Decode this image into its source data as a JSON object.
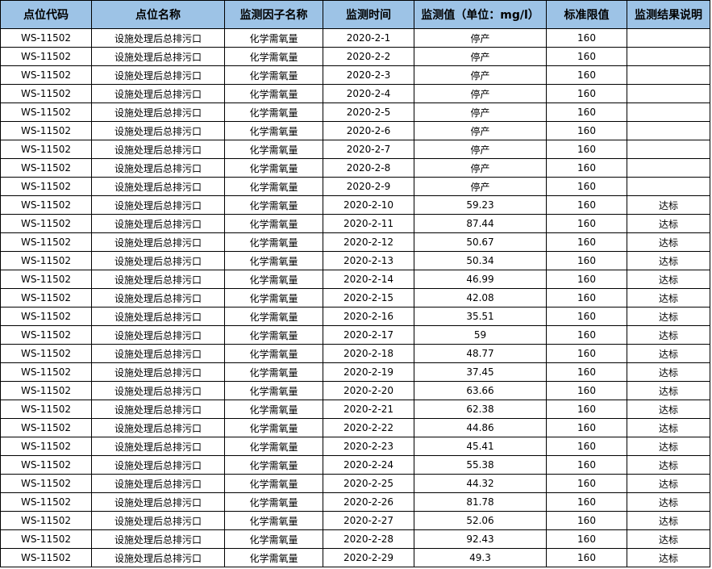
{
  "headers": [
    "点位代码",
    "点位名称",
    "监测因子名称",
    "监测时间",
    "监测值（单位：mg/l）",
    "标准限值",
    "监测结果说明"
  ],
  "rows": [
    [
      "WS-11502",
      "设施处理后总排污口",
      "化学需氧量",
      "2020-2-1",
      "停产",
      "160",
      ""
    ],
    [
      "WS-11502",
      "设施处理后总排污口",
      "化学需氧量",
      "2020-2-2",
      "停产",
      "160",
      ""
    ],
    [
      "WS-11502",
      "设施处理后总排污口",
      "化学需氧量",
      "2020-2-3",
      "停产",
      "160",
      ""
    ],
    [
      "WS-11502",
      "设施处理后总排污口",
      "化学需氧量",
      "2020-2-4",
      "停产",
      "160",
      ""
    ],
    [
      "WS-11502",
      "设施处理后总排污口",
      "化学需氧量",
      "2020-2-5",
      "停产",
      "160",
      ""
    ],
    [
      "WS-11502",
      "设施处理后总排污口",
      "化学需氧量",
      "2020-2-6",
      "停产",
      "160",
      ""
    ],
    [
      "WS-11502",
      "设施处理后总排污口",
      "化学需氧量",
      "2020-2-7",
      "停产",
      "160",
      ""
    ],
    [
      "WS-11502",
      "设施处理后总排污口",
      "化学需氧量",
      "2020-2-8",
      "停产",
      "160",
      ""
    ],
    [
      "WS-11502",
      "设施处理后总排污口",
      "化学需氧量",
      "2020-2-9",
      "停产",
      "160",
      ""
    ],
    [
      "WS-11502",
      "设施处理后总排污口",
      "化学需氧量",
      "2020-2-10",
      "59.23",
      "160",
      "达标"
    ],
    [
      "WS-11502",
      "设施处理后总排污口",
      "化学需氧量",
      "2020-2-11",
      "87.44",
      "160",
      "达标"
    ],
    [
      "WS-11502",
      "设施处理后总排污口",
      "化学需氧量",
      "2020-2-12",
      "50.67",
      "160",
      "达标"
    ],
    [
      "WS-11502",
      "设施处理后总排污口",
      "化学需氧量",
      "2020-2-13",
      "50.34",
      "160",
      "达标"
    ],
    [
      "WS-11502",
      "设施处理后总排污口",
      "化学需氧量",
      "2020-2-14",
      "46.99",
      "160",
      "达标"
    ],
    [
      "WS-11502",
      "设施处理后总排污口",
      "化学需氧量",
      "2020-2-15",
      "42.08",
      "160",
      "达标"
    ],
    [
      "WS-11502",
      "设施处理后总排污口",
      "化学需氧量",
      "2020-2-16",
      "35.51",
      "160",
      "达标"
    ],
    [
      "WS-11502",
      "设施处理后总排污口",
      "化学需氧量",
      "2020-2-17",
      "59",
      "160",
      "达标"
    ],
    [
      "WS-11502",
      "设施处理后总排污口",
      "化学需氧量",
      "2020-2-18",
      "48.77",
      "160",
      "达标"
    ],
    [
      "WS-11502",
      "设施处理后总排污口",
      "化学需氧量",
      "2020-2-19",
      "37.45",
      "160",
      "达标"
    ],
    [
      "WS-11502",
      "设施处理后总排污口",
      "化学需氧量",
      "2020-2-20",
      "63.66",
      "160",
      "达标"
    ],
    [
      "WS-11502",
      "设施处理后总排污口",
      "化学需氧量",
      "2020-2-21",
      "62.38",
      "160",
      "达标"
    ],
    [
      "WS-11502",
      "设施处理后总排污口",
      "化学需氧量",
      "2020-2-22",
      "44.86",
      "160",
      "达标"
    ],
    [
      "WS-11502",
      "设施处理后总排污口",
      "化学需氧量",
      "2020-2-23",
      "45.41",
      "160",
      "达标"
    ],
    [
      "WS-11502",
      "设施处理后总排污口",
      "化学需氧量",
      "2020-2-24",
      "55.38",
      "160",
      "达标"
    ],
    [
      "WS-11502",
      "设施处理后总排污口",
      "化学需氧量",
      "2020-2-25",
      "44.32",
      "160",
      "达标"
    ],
    [
      "WS-11502",
      "设施处理后总排污口",
      "化学需氧量",
      "2020-2-26",
      "81.78",
      "160",
      "达标"
    ],
    [
      "WS-11502",
      "设施处理后总排污口",
      "化学需氧量",
      "2020-2-27",
      "52.06",
      "160",
      "达标"
    ],
    [
      "WS-11502",
      "设施处理后总排污口",
      "化学需氧量",
      "2020-2-28",
      "92.43",
      "160",
      "达标"
    ],
    [
      "WS-11502",
      "设施处理后总排污口",
      "化学需氧量",
      "2020-2-29",
      "49.3",
      "160",
      "达标"
    ]
  ],
  "colors": {
    "header_background": "#9dc3e6",
    "border": "#000000"
  }
}
